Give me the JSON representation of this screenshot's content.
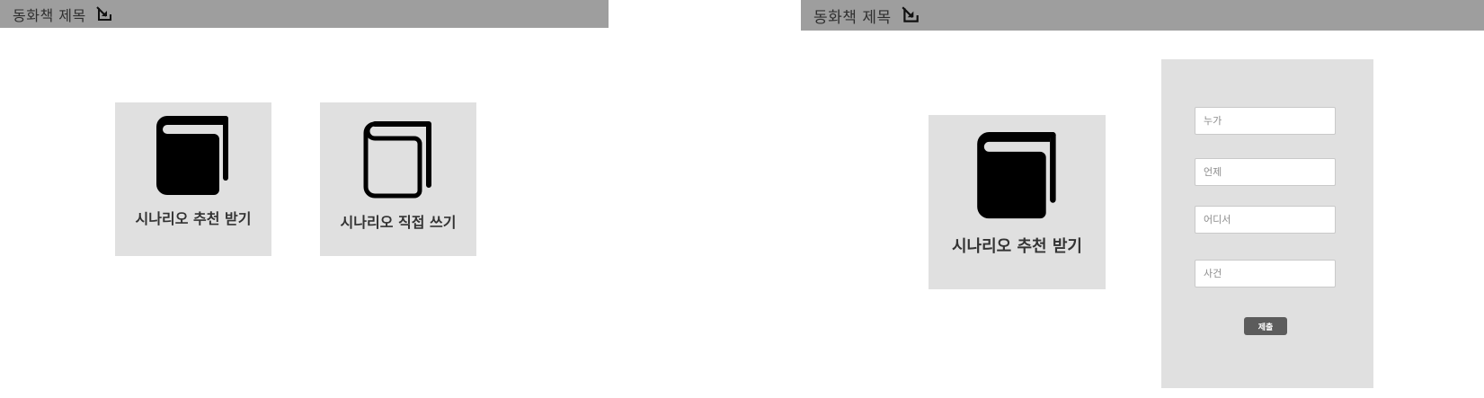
{
  "header": {
    "title": "동화책 제목",
    "edit_icon": "external-edit-icon"
  },
  "mode_select": {
    "recommend_label": "시나리오 추천 받기",
    "recommend_icon": "closed-book-icon",
    "write_label": "시나리오 직접 쓰기",
    "write_icon": "open-book-outline-icon"
  },
  "form": {
    "who_placeholder": "누가",
    "when_placeholder": "언제",
    "where_placeholder": "어디서",
    "event_placeholder": "사건",
    "submit_label": "제출"
  },
  "colors": {
    "header_bg": "#9e9e9e",
    "card_bg": "#e0e0e0",
    "submit_bg": "#5c5c5c"
  }
}
